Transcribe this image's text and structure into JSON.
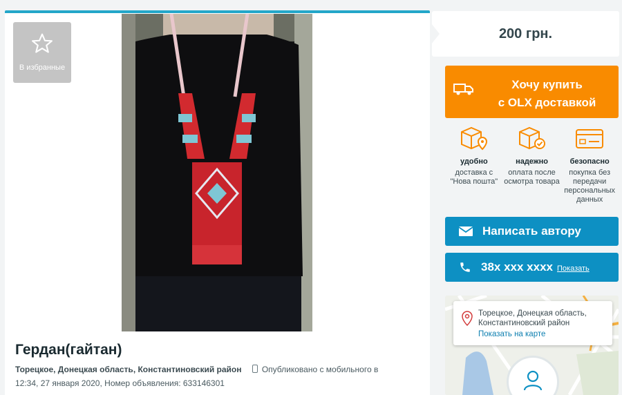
{
  "listing": {
    "favorite_label": "В избранные",
    "title": "Гердан(гайтан)",
    "location": "Торецкое, Донецкая область, Константиновский район",
    "published_mobile": "Опубликовано с мобильного",
    "published_in": "в",
    "published_time": "12:34, 27 января 2020,",
    "ad_number_label": "Номер объявления:",
    "ad_number": "633146301"
  },
  "sidebar": {
    "price": "200 грн.",
    "buy_line1": "Хочу купить",
    "buy_line2": "с OLX доставкой",
    "features": [
      {
        "icon": "box-pin-icon",
        "head": "удобно",
        "desc": "доставка с \"Нова пошта\""
      },
      {
        "icon": "box-check-icon",
        "head": "надежно",
        "desc": "оплата после осмотра товара"
      },
      {
        "icon": "card-icon",
        "head": "безопасно",
        "desc": "покупка без передачи персональных данных"
      }
    ],
    "message_label": "Написать автору",
    "phone_masked": "38x xxx xxxx",
    "phone_show": "Показать",
    "map_address": "Торецкое, Донецкая область, Константиновский район",
    "map_show": "Показать на карте"
  },
  "colors": {
    "accent_blue": "#0d90c3",
    "buy_orange": "#f98b00",
    "top_border": "#23a6c9"
  }
}
